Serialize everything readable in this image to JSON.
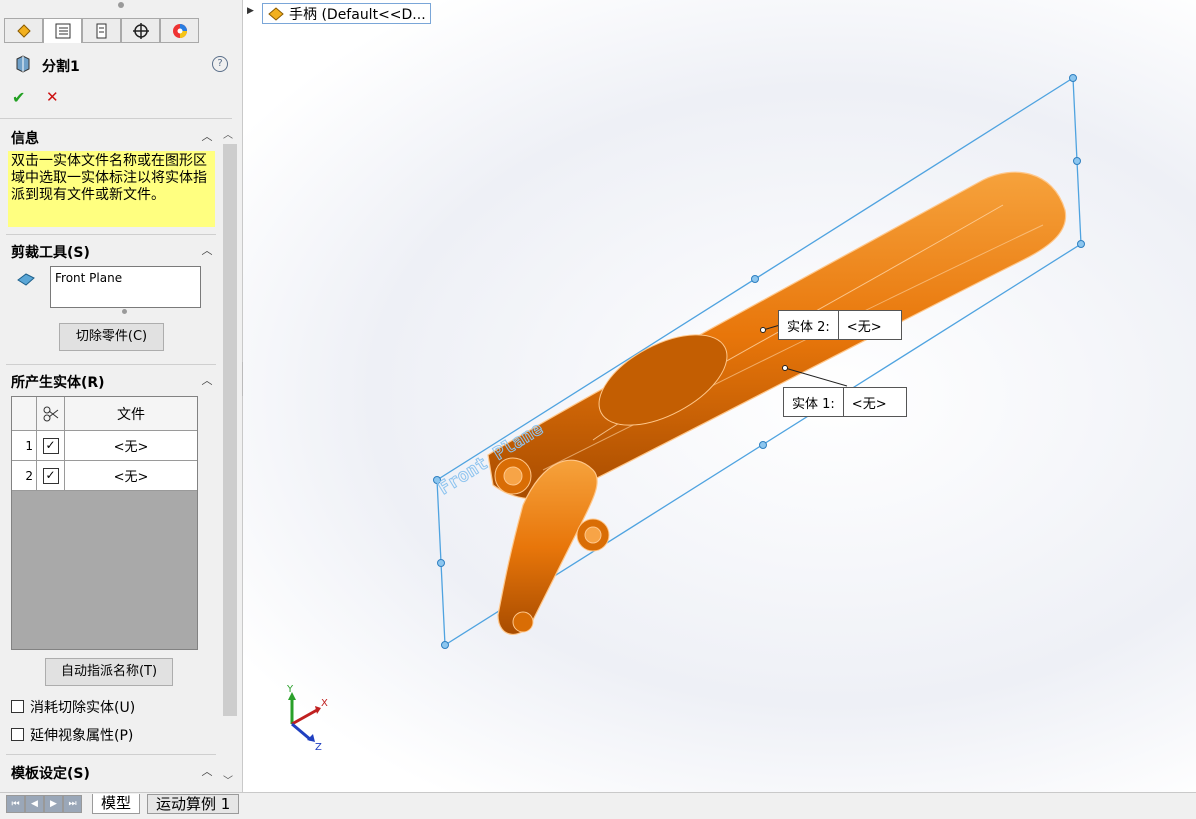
{
  "left_panel": {
    "feature_title": "分割1",
    "info": {
      "title": "信息",
      "message": "双击一实体文件名称或在图形区域中选取一实体标注以将实体指派到现有文件或新文件。"
    },
    "trim_tools": {
      "title": "剪裁工具(S)",
      "selection_value": "Front Plane",
      "cut_part_button": "切除零件(C)"
    },
    "resulting_bodies": {
      "title": "所产生实体(R)",
      "column_file": "文件",
      "rows": [
        {
          "index": "1",
          "checked": true,
          "file": "<无>"
        },
        {
          "index": "2",
          "checked": true,
          "file": "<无>"
        }
      ],
      "auto_assign_button": "自动指派名称(T)"
    },
    "options": {
      "consume_cut_bodies": "消耗切除实体(U)",
      "propagate_visual": "延伸视象属性(P)"
    },
    "template_settings": {
      "title": "模板设定(S)"
    }
  },
  "feature_tree": {
    "part_label": "手柄  (Default<<D..."
  },
  "graphics": {
    "plane_label": "Front Plane",
    "callouts": [
      {
        "label": "实体  2:",
        "value": "<无>"
      },
      {
        "label": "实体  1:",
        "value": "<无>"
      }
    ],
    "triad": {
      "x": "X",
      "y": "Y",
      "z": "Z"
    }
  },
  "bottom_tabs": {
    "model": "模型",
    "motion": "运动算例 1"
  },
  "colors": {
    "info_bg": "#ffff80",
    "part_orange": "#e8760a",
    "plane_blue": "#4fa3e0",
    "ok_green": "#22a022",
    "cancel_red": "#cc1111"
  }
}
